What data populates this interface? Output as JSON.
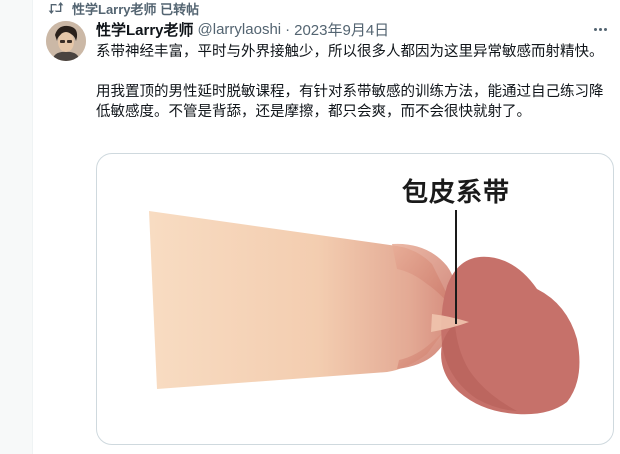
{
  "retweet": {
    "label": "性学Larry老师 已转帖",
    "icon": "retweet-icon"
  },
  "author": {
    "name": "性学Larry老师",
    "handle": "@larrylaoshi",
    "separator": "·",
    "date": "2023年9月4日",
    "avatar_icon": "avatar-portrait"
  },
  "tweet": {
    "paragraphs": [
      "系带神经丰富，平时与外界接触少，所以很多人都因为这里异常敏感而射精快。",
      "用我置顶的男性延时脱敏课程，有针对系带敏感的训练方法，能通过自己练习降低敏感度。不管是背舔，还是摩擦，都只会爽，而不会很快就射了。"
    ]
  },
  "media": {
    "label": "包皮系带",
    "colors": {
      "shaft": "#f5d2b4",
      "head": "#c87068",
      "head_dark": "#b65e58"
    }
  },
  "colors": {
    "text_primary": "#0f1419",
    "text_secondary": "#536471",
    "border": "#cfd9de",
    "background": "#f7f9f9"
  }
}
